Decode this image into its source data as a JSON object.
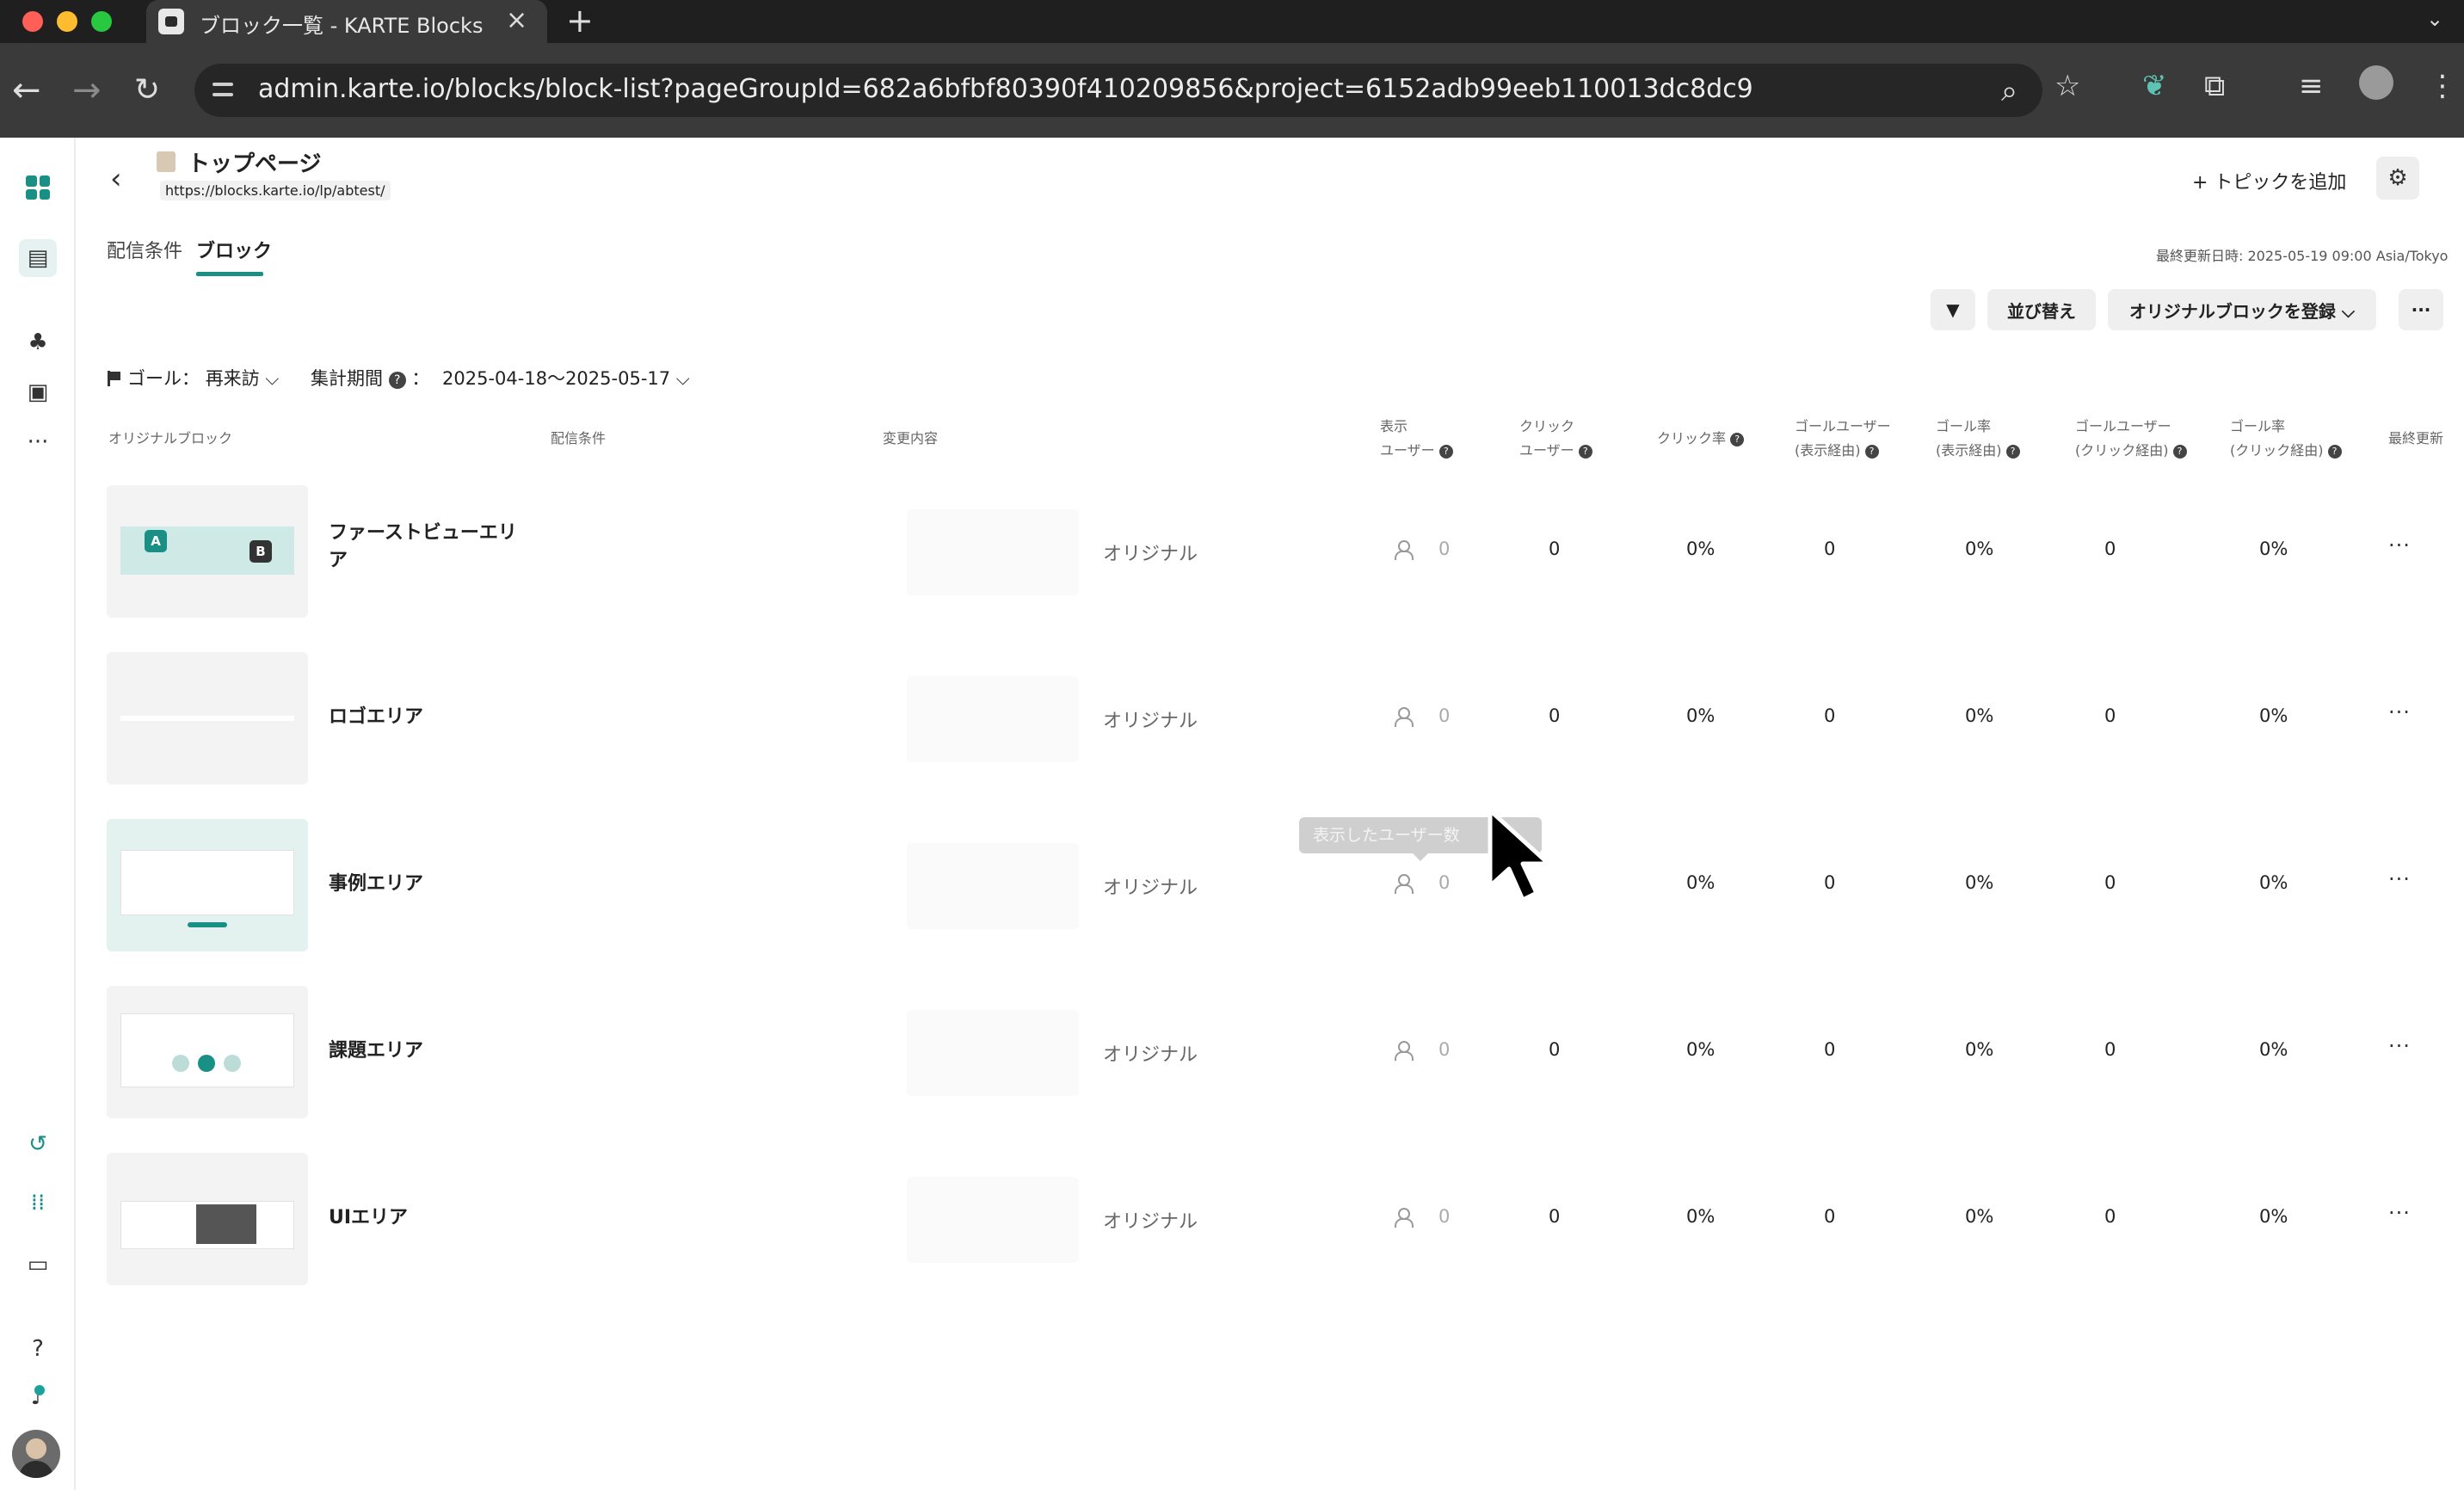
{
  "browser": {
    "tab_title": "ブロック一覧 - KARTE Blocks",
    "url": "admin.karte.io/blocks/block-list?pageGroupId=682a6bfbf80390f410209856&project=6152adb99eeb110013dc8dc9"
  },
  "header": {
    "title": "トップページ",
    "page_url": "https://blocks.karte.io/lp/abtest/",
    "add_topic_label": "+ トピックを追加"
  },
  "tabs": [
    {
      "label": "配信条件",
      "active": false
    },
    {
      "label": "ブロック",
      "active": true
    }
  ],
  "last_updated": "最終更新日時: 2025-05-19 09:00 Asia/Tokyo",
  "toolbar": {
    "sort_label": "並び替え",
    "register_label": "オリジナルブロックを登録 ⌵",
    "more_label": "···"
  },
  "filters": {
    "goal_label": "ゴール：",
    "goal_value": "再来訪 ⌵",
    "period_label": "集計期間",
    "period_sep": "：",
    "period_value": "2025-04-18〜2025-05-17 ⌵"
  },
  "columns": {
    "original_block": "オリジナルブロック",
    "conditions": "配信条件",
    "changes": "変更内容",
    "view_users_1": "表示",
    "view_users_2": "ユーザー",
    "click_users_1": "クリック",
    "click_users_2": "ユーザー",
    "click_rate": "クリック率",
    "goal_users_view_1": "ゴールユーザー",
    "goal_users_view_2": "(表示経由)",
    "goal_rate_view_1": "ゴール率",
    "goal_rate_view_2": "(表示経由)",
    "goal_users_click_1": "ゴールユーザー",
    "goal_users_click_2": "(クリック経由)",
    "goal_rate_click_1": "ゴール率",
    "goal_rate_click_2": "(クリック経由)",
    "last_updated": "最終更新"
  },
  "rows": [
    {
      "name": "ファーストビューエリア",
      "change": "オリジナル",
      "view_users": "0",
      "click_users": "0",
      "click_rate": "0%",
      "goal_users_view": "0",
      "goal_rate_view": "0%",
      "goal_users_click": "0",
      "goal_rate_click": "0%"
    },
    {
      "name": "ロゴエリア",
      "change": "オリジナル",
      "view_users": "0",
      "click_users": "0",
      "click_rate": "0%",
      "goal_users_view": "0",
      "goal_rate_view": "0%",
      "goal_users_click": "0",
      "goal_rate_click": "0%"
    },
    {
      "name": "事例エリア",
      "change": "オリジナル",
      "view_users": "0",
      "click_users": "",
      "click_rate": "0%",
      "goal_users_view": "0",
      "goal_rate_view": "0%",
      "goal_users_click": "0",
      "goal_rate_click": "0%"
    },
    {
      "name": "課題エリア",
      "change": "オリジナル",
      "view_users": "0",
      "click_users": "0",
      "click_rate": "0%",
      "goal_users_view": "0",
      "goal_rate_view": "0%",
      "goal_users_click": "0",
      "goal_rate_click": "0%"
    },
    {
      "name": "UIエリア",
      "change": "オリジナル",
      "view_users": "0",
      "click_users": "0",
      "click_rate": "0%",
      "goal_users_view": "0",
      "goal_rate_view": "0%",
      "goal_users_click": "0",
      "goal_rate_click": "0%"
    }
  ],
  "tooltip": "表示したユーザー数",
  "thumb_badges": {
    "a": "A",
    "b": "B"
  },
  "row_menu": "···",
  "colors": {
    "accent": "#1a8f86"
  }
}
